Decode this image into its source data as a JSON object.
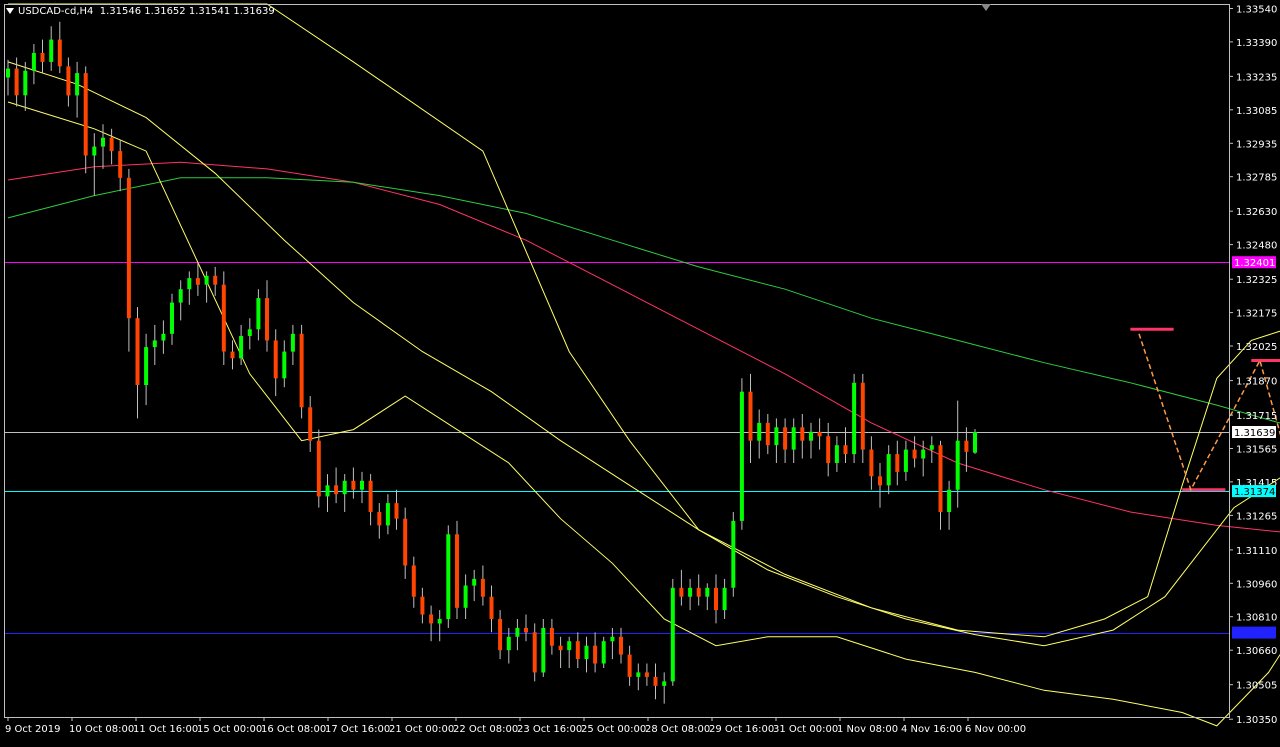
{
  "header": {
    "symbol": "USDCAD-cd,H4",
    "ohlc": "1.31546 1.31652 1.31541 1.31639"
  },
  "colors": {
    "background": "#000000",
    "frame": "#c0c0c0",
    "bull_candle": "#00ff00",
    "bear_candle": "#ff4500",
    "wick": "#c0c0c0",
    "bollinger": "#ffff66",
    "ma_green": "#2ecc40",
    "ma_pink": "#ff3366",
    "annotation": "#ff3366",
    "arrow": "#ff9944"
  },
  "chart_data": {
    "type": "candlestick",
    "symbol": "USDCAD-cd",
    "timeframe": "H4",
    "ylim": [
      1.3036,
      1.3356
    ],
    "y_ticks": [
      "1.33540",
      "1.33390",
      "1.33235",
      "1.33085",
      "1.32935",
      "1.32785",
      "1.32630",
      "1.32480",
      "1.32325",
      "1.32175",
      "1.32025",
      "1.31870",
      "1.31715",
      "1.31565",
      "1.31415",
      "1.31265",
      "1.31110",
      "1.30960",
      "1.30810",
      "1.30660",
      "1.30505",
      "1.30350"
    ],
    "x_ticks": [
      "9 Oct 2019",
      "10 Oct 08:00",
      "11 Oct 16:00",
      "15 Oct 00:00",
      "16 Oct 08:00",
      "17 Oct 16:00",
      "21 Oct 00:00",
      "22 Oct 08:00",
      "23 Oct 16:00",
      "25 Oct 00:00",
      "28 Oct 08:00",
      "29 Oct 16:00",
      "31 Oct 00:00",
      "1 Nov 08:00",
      "4 Nov 16:00",
      "6 Nov 00:00"
    ],
    "horizontal_lines": [
      {
        "value": 1.32401,
        "label": "1.32401",
        "color": "#ff00ff",
        "label_bg": "#ff00ff",
        "label_fg": "#ffffff"
      },
      {
        "value": 1.31639,
        "label": "1.31639",
        "color": "#c0c0c0",
        "label_bg": "#ffffff",
        "label_fg": "#000000"
      },
      {
        "value": 1.31374,
        "label": "1.31374",
        "color": "#00ffff",
        "label_bg": "#00ffff",
        "label_fg": "#000000"
      },
      {
        "value": 1.30739,
        "label": "1.30739",
        "color": "#2222ff",
        "label_bg": "#2222ff",
        "label_fg": "#2222ff"
      }
    ],
    "candles": [
      [
        1.3323,
        1.3331,
        1.3315,
        1.3327
      ],
      [
        1.3327,
        1.3332,
        1.331,
        1.3315
      ],
      [
        1.3315,
        1.333,
        1.3308,
        1.3326
      ],
      [
        1.3326,
        1.3338,
        1.332,
        1.3334
      ],
      [
        1.3334,
        1.334,
        1.3325,
        1.333
      ],
      [
        1.333,
        1.3346,
        1.3326,
        1.334
      ],
      [
        1.334,
        1.3348,
        1.3325,
        1.3328
      ],
      [
        1.3328,
        1.3332,
        1.331,
        1.3315
      ],
      [
        1.3315,
        1.333,
        1.3305,
        1.3325
      ],
      [
        1.3325,
        1.3328,
        1.328,
        1.3288
      ],
      [
        1.3288,
        1.3298,
        1.327,
        1.3292
      ],
      [
        1.3292,
        1.3302,
        1.3282,
        1.3296
      ],
      [
        1.3296,
        1.33,
        1.3284,
        1.329
      ],
      [
        1.329,
        1.3295,
        1.3272,
        1.3278
      ],
      [
        1.3278,
        1.3282,
        1.32,
        1.3215
      ],
      [
        1.3215,
        1.322,
        1.317,
        1.3185
      ],
      [
        1.3185,
        1.3208,
        1.3176,
        1.3202
      ],
      [
        1.3202,
        1.3212,
        1.3194,
        1.3205
      ],
      [
        1.3205,
        1.3214,
        1.3199,
        1.3208
      ],
      [
        1.3208,
        1.3226,
        1.3203,
        1.3222
      ],
      [
        1.3222,
        1.3232,
        1.3214,
        1.3228
      ],
      [
        1.3228,
        1.3236,
        1.3221,
        1.3233
      ],
      [
        1.3233,
        1.324,
        1.3225,
        1.323
      ],
      [
        1.323,
        1.3236,
        1.3222,
        1.3234
      ],
      [
        1.3234,
        1.3238,
        1.3225,
        1.323
      ],
      [
        1.323,
        1.3236,
        1.3194,
        1.32
      ],
      [
        1.32,
        1.3205,
        1.3192,
        1.3197
      ],
      [
        1.3197,
        1.3212,
        1.3194,
        1.3207
      ],
      [
        1.3207,
        1.3215,
        1.3201,
        1.321
      ],
      [
        1.321,
        1.3228,
        1.3205,
        1.3224
      ],
      [
        1.3224,
        1.3232,
        1.32,
        1.3205
      ],
      [
        1.3205,
        1.321,
        1.318,
        1.3188
      ],
      [
        1.3188,
        1.3205,
        1.3184,
        1.32
      ],
      [
        1.32,
        1.3212,
        1.3194,
        1.3208
      ],
      [
        1.3208,
        1.3212,
        1.317,
        1.3175
      ],
      [
        1.3175,
        1.318,
        1.3155,
        1.316
      ],
      [
        1.316,
        1.3165,
        1.313,
        1.3135
      ],
      [
        1.3135,
        1.3145,
        1.3128,
        1.314
      ],
      [
        1.314,
        1.3148,
        1.3132,
        1.3136
      ],
      [
        1.3136,
        1.3145,
        1.3128,
        1.3142
      ],
      [
        1.3142,
        1.3148,
        1.3134,
        1.3138
      ],
      [
        1.3138,
        1.3146,
        1.3132,
        1.3142
      ],
      [
        1.3142,
        1.3145,
        1.3122,
        1.3128
      ],
      [
        1.3128,
        1.3132,
        1.3116,
        1.3122
      ],
      [
        1.3122,
        1.3136,
        1.3118,
        1.3132
      ],
      [
        1.3132,
        1.3138,
        1.312,
        1.3125
      ],
      [
        1.3125,
        1.313,
        1.3098,
        1.3104
      ],
      [
        1.3104,
        1.3108,
        1.3085,
        1.309
      ],
      [
        1.309,
        1.3094,
        1.3078,
        1.3082
      ],
      [
        1.3082,
        1.3086,
        1.307,
        1.3078
      ],
      [
        1.3078,
        1.3084,
        1.307,
        1.308
      ],
      [
        1.308,
        1.3122,
        1.3076,
        1.3118
      ],
      [
        1.3118,
        1.3124,
        1.308,
        1.3085
      ],
      [
        1.3085,
        1.31,
        1.308,
        1.3095
      ],
      [
        1.3095,
        1.3102,
        1.3088,
        1.3098
      ],
      [
        1.3098,
        1.3104,
        1.3086,
        1.309
      ],
      [
        1.309,
        1.3095,
        1.3074,
        1.308
      ],
      [
        1.308,
        1.3084,
        1.3062,
        1.3066
      ],
      [
        1.3066,
        1.3076,
        1.306,
        1.3072
      ],
      [
        1.3072,
        1.308,
        1.3066,
        1.3076
      ],
      [
        1.3076,
        1.3082,
        1.307,
        1.3074
      ],
      [
        1.3074,
        1.3078,
        1.3052,
        1.3056
      ],
      [
        1.3056,
        1.308,
        1.3054,
        1.3076
      ],
      [
        1.3076,
        1.308,
        1.3064,
        1.3068
      ],
      [
        1.3068,
        1.3072,
        1.3058,
        1.3066
      ],
      [
        1.3066,
        1.3072,
        1.3058,
        1.307
      ],
      [
        1.307,
        1.3074,
        1.3058,
        1.3062
      ],
      [
        1.3062,
        1.3072,
        1.3056,
        1.3068
      ],
      [
        1.3068,
        1.3074,
        1.3056,
        1.306
      ],
      [
        1.306,
        1.3072,
        1.3058,
        1.307
      ],
      [
        1.307,
        1.3076,
        1.3062,
        1.3072
      ],
      [
        1.3072,
        1.3076,
        1.306,
        1.3064
      ],
      [
        1.3064,
        1.3068,
        1.305,
        1.3054
      ],
      [
        1.3054,
        1.306,
        1.3048,
        1.3056
      ],
      [
        1.3056,
        1.306,
        1.305,
        1.3054
      ],
      [
        1.3054,
        1.306,
        1.3044,
        1.305
      ],
      [
        1.305,
        1.3056,
        1.3042,
        1.3052
      ],
      [
        1.3052,
        1.3098,
        1.305,
        1.3094
      ],
      [
        1.3094,
        1.3102,
        1.3086,
        1.309
      ],
      [
        1.309,
        1.3098,
        1.3084,
        1.3094
      ],
      [
        1.3094,
        1.31,
        1.3086,
        1.309
      ],
      [
        1.309,
        1.3096,
        1.3084,
        1.3094
      ],
      [
        1.3094,
        1.31,
        1.3078,
        1.3084
      ],
      [
        1.3084,
        1.3098,
        1.308,
        1.3094
      ],
      [
        1.3094,
        1.3128,
        1.309,
        1.3124
      ],
      [
        1.3124,
        1.3188,
        1.312,
        1.3182
      ],
      [
        1.3182,
        1.319,
        1.315,
        1.316
      ],
      [
        1.316,
        1.3174,
        1.3152,
        1.3168
      ],
      [
        1.3168,
        1.3172,
        1.3154,
        1.3158
      ],
      [
        1.3158,
        1.317,
        1.315,
        1.3166
      ],
      [
        1.3166,
        1.317,
        1.315,
        1.3156
      ],
      [
        1.3156,
        1.317,
        1.315,
        1.3166
      ],
      [
        1.3166,
        1.3172,
        1.3152,
        1.316
      ],
      [
        1.316,
        1.3168,
        1.3152,
        1.3164
      ],
      [
        1.3164,
        1.317,
        1.3156,
        1.3162
      ],
      [
        1.3162,
        1.3168,
        1.3144,
        1.315
      ],
      [
        1.315,
        1.3162,
        1.3146,
        1.3158
      ],
      [
        1.3158,
        1.3166,
        1.315,
        1.3154
      ],
      [
        1.3154,
        1.319,
        1.315,
        1.3186
      ],
      [
        1.3186,
        1.319,
        1.315,
        1.3156
      ],
      [
        1.3156,
        1.3162,
        1.3138,
        1.3144
      ],
      [
        1.3144,
        1.315,
        1.313,
        1.314
      ],
      [
        1.314,
        1.3158,
        1.3136,
        1.3154
      ],
      [
        1.3154,
        1.316,
        1.314,
        1.3146
      ],
      [
        1.3146,
        1.316,
        1.3142,
        1.3156
      ],
      [
        1.3156,
        1.3162,
        1.3148,
        1.3152
      ],
      [
        1.3152,
        1.316,
        1.3144,
        1.3156
      ],
      [
        1.3156,
        1.3162,
        1.315,
        1.3158
      ],
      [
        1.3158,
        1.316,
        1.312,
        1.3128
      ],
      [
        1.3128,
        1.3142,
        1.312,
        1.3138
      ],
      [
        1.3138,
        1.3178,
        1.313,
        1.316
      ],
      [
        1.316,
        1.3166,
        1.3146,
        1.3155
      ],
      [
        1.31546,
        1.31652,
        1.31541,
        1.31639
      ]
    ],
    "bb_upper": [
      [
        0,
        1.3356
      ],
      [
        30,
        1.3356
      ],
      [
        40,
        1.333
      ],
      [
        55,
        1.329
      ],
      [
        65,
        1.32
      ],
      [
        72,
        1.316
      ],
      [
        80,
        1.312
      ],
      [
        90,
        1.31
      ],
      [
        100,
        1.3085
      ],
      [
        110,
        1.3075
      ],
      [
        120,
        1.3072
      ],
      [
        127,
        1.308
      ],
      [
        132,
        1.309
      ],
      [
        136,
        1.314
      ],
      [
        140,
        1.3188
      ],
      [
        144,
        1.3205
      ],
      [
        148,
        1.321
      ],
      [
        152,
        1.3202
      ],
      [
        156,
        1.318
      ],
      [
        160,
        1.3175
      ],
      [
        164,
        1.3176
      ],
      [
        168,
        1.3175
      ]
    ],
    "bb_mid": [
      [
        0,
        1.333
      ],
      [
        8,
        1.332
      ],
      [
        16,
        1.3305
      ],
      [
        24,
        1.328
      ],
      [
        32,
        1.325
      ],
      [
        40,
        1.3222
      ],
      [
        48,
        1.32
      ],
      [
        56,
        1.3182
      ],
      [
        64,
        1.316
      ],
      [
        72,
        1.314
      ],
      [
        80,
        1.312
      ],
      [
        88,
        1.3102
      ],
      [
        96,
        1.309
      ],
      [
        104,
        1.308
      ],
      [
        112,
        1.3073
      ],
      [
        120,
        1.3068
      ],
      [
        128,
        1.3075
      ],
      [
        134,
        1.309
      ],
      [
        138,
        1.311
      ],
      [
        142,
        1.313
      ],
      [
        146,
        1.314
      ],
      [
        150,
        1.315
      ],
      [
        154,
        1.3154
      ],
      [
        158,
        1.3156
      ],
      [
        162,
        1.3152
      ],
      [
        166,
        1.315
      ],
      [
        168,
        1.315
      ]
    ],
    "bb_lower": [
      [
        0,
        1.3312
      ],
      [
        10,
        1.33
      ],
      [
        16,
        1.329
      ],
      [
        22,
        1.324
      ],
      [
        28,
        1.319
      ],
      [
        34,
        1.316
      ],
      [
        40,
        1.3165
      ],
      [
        46,
        1.318
      ],
      [
        52,
        1.3165
      ],
      [
        58,
        1.315
      ],
      [
        64,
        1.3125
      ],
      [
        70,
        1.3105
      ],
      [
        76,
        1.308
      ],
      [
        82,
        1.3068
      ],
      [
        88,
        1.3072
      ],
      [
        96,
        1.3072
      ],
      [
        104,
        1.3062
      ],
      [
        112,
        1.3056
      ],
      [
        120,
        1.3048
      ],
      [
        128,
        1.3044
      ],
      [
        136,
        1.3038
      ],
      [
        140,
        1.3032
      ],
      [
        146,
        1.3056
      ],
      [
        150,
        1.308
      ],
      [
        154,
        1.3105
      ],
      [
        158,
        1.313
      ],
      [
        162,
        1.3138
      ],
      [
        166,
        1.314
      ],
      [
        168,
        1.314
      ]
    ],
    "ma_green": [
      [
        0,
        1.326
      ],
      [
        10,
        1.327
      ],
      [
        20,
        1.3278
      ],
      [
        30,
        1.3278
      ],
      [
        40,
        1.3276
      ],
      [
        50,
        1.327
      ],
      [
        60,
        1.3262
      ],
      [
        70,
        1.325
      ],
      [
        80,
        1.3238
      ],
      [
        90,
        1.3228
      ],
      [
        100,
        1.3215
      ],
      [
        110,
        1.3205
      ],
      [
        120,
        1.3195
      ],
      [
        130,
        1.3186
      ],
      [
        140,
        1.3176
      ],
      [
        150,
        1.3165
      ],
      [
        160,
        1.3156
      ],
      [
        168,
        1.315
      ]
    ],
    "ma_pink": [
      [
        0,
        1.3277
      ],
      [
        10,
        1.3283
      ],
      [
        20,
        1.3285
      ],
      [
        30,
        1.3282
      ],
      [
        40,
        1.3276
      ],
      [
        50,
        1.3266
      ],
      [
        60,
        1.325
      ],
      [
        70,
        1.323
      ],
      [
        80,
        1.321
      ],
      [
        90,
        1.319
      ],
      [
        100,
        1.3168
      ],
      [
        110,
        1.315
      ],
      [
        120,
        1.3138
      ],
      [
        130,
        1.3128
      ],
      [
        140,
        1.3122
      ],
      [
        150,
        1.3118
      ],
      [
        160,
        1.3113
      ],
      [
        168,
        1.311
      ]
    ],
    "annotations": {
      "dashes": [
        {
          "x1": 130,
          "x2": 135,
          "y": 1.321
        },
        {
          "x1": 136,
          "x2": 141,
          "y": 1.3138
        },
        {
          "x1": 144,
          "x2": 149,
          "y": 1.3196
        },
        {
          "x1": 150,
          "x2": 155,
          "y": 1.3164
        },
        {
          "x1": 151,
          "x2": 156,
          "y": 1.3131
        },
        {
          "x1": 158,
          "x2": 163,
          "y": 1.3164
        }
      ],
      "zigzag": [
        [
          131,
          1.3208
        ],
        [
          137,
          1.3138
        ],
        [
          145,
          1.3196
        ],
        [
          149,
          1.314
        ],
        [
          152,
          1.3164
        ],
        [
          155,
          1.3131
        ],
        [
          157,
          1.3164
        ],
        [
          160,
          1.3164
        ],
        [
          163,
          1.314
        ]
      ],
      "arrow": [
        [
          160,
          1.3164
        ],
        [
          168,
          1.3124
        ]
      ],
      "circle": {
        "x": 163,
        "y": 1.3145
      }
    }
  }
}
